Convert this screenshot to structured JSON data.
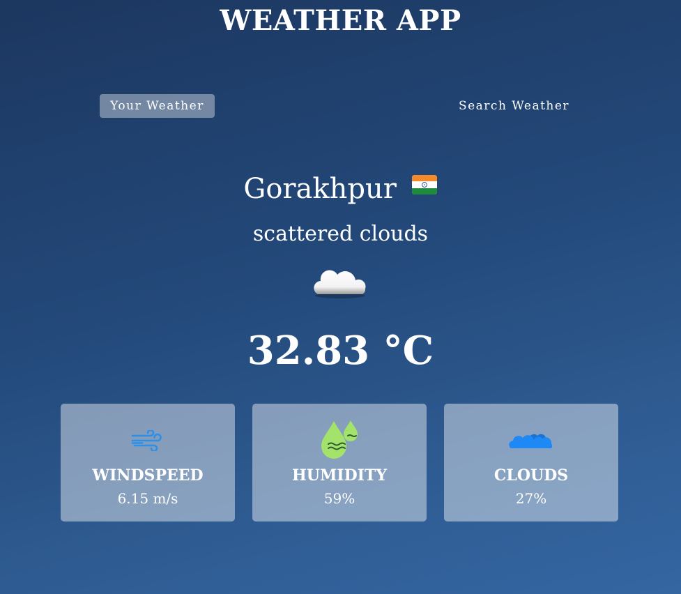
{
  "app": {
    "title": "WEATHER APP"
  },
  "tabs": [
    {
      "label": "Your Weather",
      "active": true
    },
    {
      "label": "Search Weather",
      "active": false
    }
  ],
  "location": {
    "city": "Gorakhpur",
    "country_flag_icon": "india-flag-icon"
  },
  "weather": {
    "condition": "scattered clouds",
    "icon": "cloud-icon",
    "temperature": "32.83 °C"
  },
  "stats": [
    {
      "title": "WINDSPEED",
      "value": "6.15 m/s",
      "icon": "wind-icon"
    },
    {
      "title": "HUMIDITY",
      "value": "59%",
      "icon": "humidity-icon"
    },
    {
      "title": "CLOUDS",
      "value": "27%",
      "icon": "clouds-icon"
    }
  ],
  "colors": {
    "background_top": "#1c3760",
    "background_bottom": "#3566a2",
    "card_background": "rgba(255,255,255,0.43)",
    "wind_icon": "#2f8fe6",
    "humidity_icon": "#a3e36b",
    "clouds_icon": "#1e88f5"
  }
}
